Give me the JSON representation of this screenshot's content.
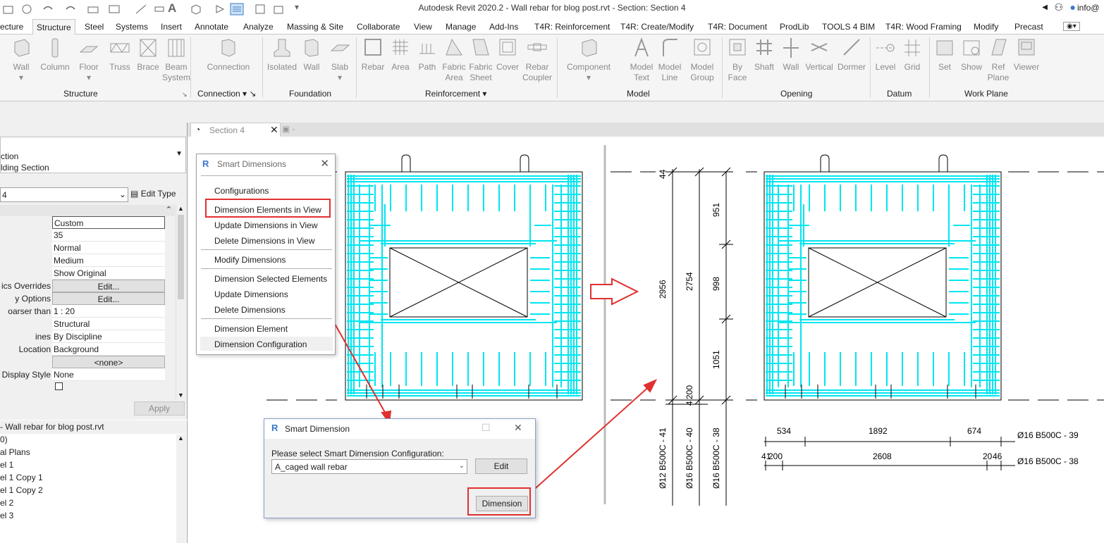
{
  "window": {
    "title": "Autodesk Revit 2020.2 - Wall rebar for blog post.rvt - Section: Section 4",
    "user": "info@"
  },
  "ribbon_tabs": [
    "ecture",
    "Structure",
    "Steel",
    "Systems",
    "Insert",
    "Annotate",
    "Analyze",
    "Massing & Site",
    "Collaborate",
    "View",
    "Manage",
    "Add-Ins",
    "T4R: Reinforcement",
    "T4R: Create/Modify",
    "T4R: Document",
    "ProdLib",
    "TOOLS 4 BIM",
    "T4R: Wood Framing",
    "Modify",
    "Precast"
  ],
  "ribbon_buttons": {
    "wall": "Wall",
    "column": "Column",
    "floor": "Floor",
    "truss": "Truss",
    "brace": "Brace",
    "beam_system_1": "Beam",
    "beam_system_2": "System",
    "connection": "Connection",
    "isolated": "Isolated",
    "fwall": "Wall",
    "slab": "Slab",
    "rebar": "Rebar",
    "area": "Area",
    "path": "Path",
    "fabric_area_1": "Fabric",
    "fabric_area_2": "Area",
    "fabric_sheet_1": "Fabric",
    "fabric_sheet_2": "Sheet",
    "cover": "Cover",
    "rebar_coupler_1": "Rebar",
    "rebar_coupler_2": "Coupler",
    "component": "Component",
    "model_text_1": "Model",
    "model_text_2": "Text",
    "model_line_1": "Model",
    "model_line_2": "Line",
    "model_group_1": "Model",
    "model_group_2": "Group",
    "by_face_1": "By",
    "by_face_2": "Face",
    "shaft": "Shaft",
    "owall": "Wall",
    "vertical": "Vertical",
    "dormer": "Dormer",
    "level": "Level",
    "grid": "Grid",
    "set": "Set",
    "show": "Show",
    "ref_plane_1": "Ref",
    "ref_plane_2": "Plane",
    "viewer": "Viewer"
  },
  "ribbon_panels": {
    "structure": "Structure",
    "connection": "Connection",
    "foundation": "Foundation",
    "reinforcement": "Reinforcement",
    "model": "Model",
    "opening": "Opening",
    "datum": "Datum",
    "work_plane": "Work Plane"
  },
  "properties": {
    "type_line1": "ction",
    "type_line2": "lding Section",
    "selector_value": "4",
    "edit_type": "Edit Type",
    "rows": [
      {
        "k": "",
        "v": "Custom"
      },
      {
        "k": "",
        "v": "35"
      },
      {
        "k": "",
        "v": "Normal"
      },
      {
        "k": "",
        "v": "Medium"
      },
      {
        "k": "",
        "v": "Show Original"
      },
      {
        "k": "ics Overrides",
        "v": "Edit..."
      },
      {
        "k": "y Options",
        "v": "Edit..."
      },
      {
        "k": "oarser than",
        "v": "1 : 20"
      },
      {
        "k": "",
        "v": "Structural"
      },
      {
        "k": "ines",
        "v": "By Discipline"
      },
      {
        "k": "Location",
        "v": "Background"
      },
      {
        "k": "",
        "v": "<none>"
      },
      {
        "k": "s Display Style",
        "v": "None"
      }
    ],
    "apply": "Apply"
  },
  "project_browser": {
    "header": "- Wall rebar for blog post.rvt",
    "items": [
      "0)",
      "al Plans",
      "el 1",
      "el 1 Copy 1",
      "el 1 Copy 2",
      "el 2",
      "el 3"
    ]
  },
  "view_tab": {
    "label": "Section 4"
  },
  "smart_menu": {
    "title": "Smart Dimensions",
    "items": [
      "Configurations",
      "Dimension Elements in View",
      "Update Dimensions in View",
      "Delete Dimensions in View",
      "Modify Dimensions",
      "Dimension Selected Elements",
      "Update Dimensions",
      "Delete Dimensions",
      "Dimension Element",
      "Dimension Configuration"
    ]
  },
  "smart_dialog": {
    "title": "Smart Dimension",
    "prompt": "Please select Smart Dimension Configuration:",
    "selected": "A_caged wall rebar",
    "edit": "Edit",
    "dimension": "Dimension"
  },
  "dimensions": {
    "v_overall_1": "2956",
    "v_overall_2": "2754",
    "v_top_small": "44",
    "v_seg_951": "951",
    "v_seg_998": "998",
    "v_seg_1051": "1051",
    "v_bottom_1": "4",
    "v_bottom_2": "200",
    "h_534": "534",
    "h_1892": "1892",
    "h_674": "674",
    "h_41": "41",
    "h_200": "200",
    "h_2608": "2608",
    "h_20": "20",
    "h_46": "46",
    "tag_v1": "Ø12 B500C - 41",
    "tag_v2": "Ø16 B500C - 40",
    "tag_v3": "Ø16 B500C - 38",
    "tag_h1": "Ø16 B500C  - 39",
    "tag_h2": "Ø16 B500C  - 38"
  },
  "colors": {
    "rebar": "#00e5f0",
    "highlight": "#e03030",
    "arrow": "#e03030"
  }
}
